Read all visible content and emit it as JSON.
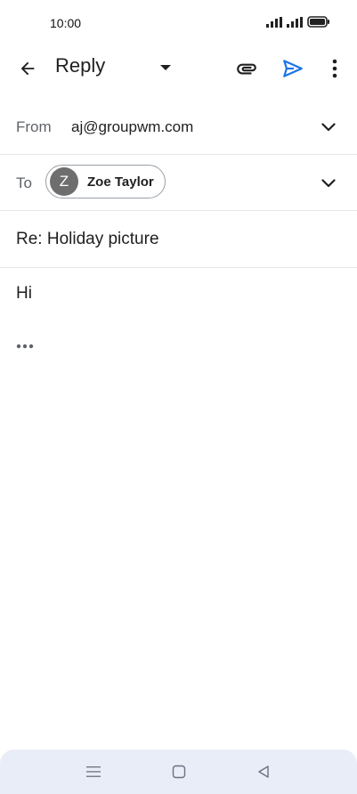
{
  "status_bar": {
    "time": "10:00",
    "icons": [
      "signal-icon",
      "signal-icon",
      "battery-icon"
    ]
  },
  "app_bar": {
    "title": "Reply",
    "icons": [
      "back-arrow-icon",
      "dropdown-arrow-icon",
      "attachment-icon",
      "send-icon",
      "more-vert-icon"
    ],
    "accent_color": "#1a73e8"
  },
  "compose": {
    "from_label": "From",
    "from_value": "aj@groupwm.com",
    "to_label": "To",
    "recipient": {
      "initial": "Z",
      "name": "Zoe Taylor"
    },
    "subject": "Re: Holiday picture",
    "body": "Hi"
  },
  "nav_bar": {
    "icons": [
      "menu-icon",
      "home-icon",
      "back-icon"
    ]
  }
}
